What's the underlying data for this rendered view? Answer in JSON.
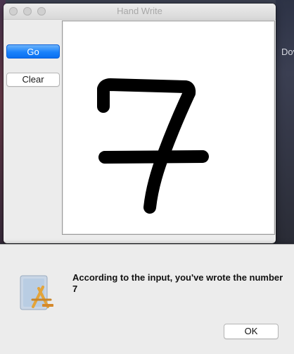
{
  "window": {
    "title": "Hand Write"
  },
  "toolbar": {
    "go_label": "Go",
    "clear_label": "Clear"
  },
  "canvas": {
    "drawn_digit": "7",
    "stroke_color": "#000000"
  },
  "alert": {
    "message": "According to the input, you've wrote the number 7",
    "ok_label": "OK",
    "icon": "app-icon"
  },
  "desktop": {
    "fragment_text": "Dov"
  },
  "colors": {
    "accent": "#1a82fb",
    "window_bg": "#ececec"
  }
}
